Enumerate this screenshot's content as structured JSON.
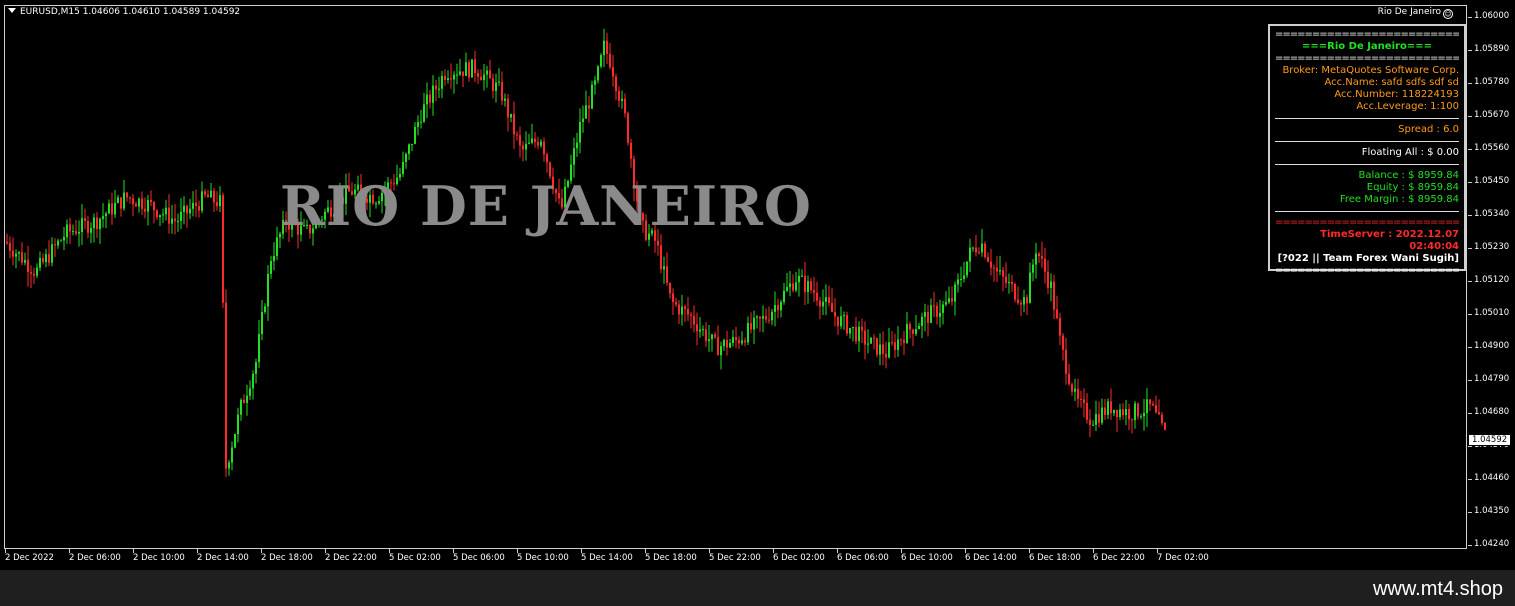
{
  "header": {
    "symbol_line": "EURUSD,M15  1.04606 1.04610 1.04589 1.04592",
    "ea_name": "Rio De Janeiro",
    "ea_icon": "smiley-icon"
  },
  "watermark": "RIO DE JANEIRO",
  "y_axis": [
    "1.06000",
    "1.05890",
    "1.05780",
    "1.05670",
    "1.05560",
    "1.05450",
    "1.05340",
    "1.05230",
    "1.05120",
    "1.05010",
    "1.04900",
    "1.04790",
    "1.04680",
    "1.04570",
    "1.04460",
    "1.04350",
    "1.04240"
  ],
  "x_axis": [
    "2 Dec 2022",
    "2 Dec 06:00",
    "2 Dec 10:00",
    "2 Dec 14:00",
    "2 Dec 18:00",
    "2 Dec 22:00",
    "5 Dec 02:00",
    "5 Dec 06:00",
    "5 Dec 10:00",
    "5 Dec 14:00",
    "5 Dec 18:00",
    "5 Dec 22:00",
    "6 Dec 02:00",
    "6 Dec 06:00",
    "6 Dec 10:00",
    "6 Dec 14:00",
    "6 Dec 18:00",
    "6 Dec 22:00",
    "7 Dec 02:00"
  ],
  "current_price": "1.04592",
  "panel": {
    "sep": "============================",
    "title": "===Rio De Janeiro===",
    "broker": "Broker: MetaQuotes Software Corp.",
    "acc_name": "Acc.Name: safd    sdfs sdf  sd",
    "acc_number": "Acc.Number: 118224193",
    "acc_leverage": "Acc.Leverage: 1:100",
    "spread": "Spread :  6.0",
    "floating": "Floating All  : $ 0.00",
    "balance": "Balance   : $ 8959.84",
    "equity": "Equity   : $ 8959.84",
    "free_margin": "Free Margin : $ 8959.84",
    "red_sep": "============================",
    "time_server": "TimeServer : 2022.12.07 02:40:04",
    "team": "[?022 || Team Forex Wani Sugih]"
  },
  "footer": {
    "site": "www.mt4.shop"
  },
  "colors": {
    "bull": "#22e022",
    "bear": "#ff2a2a",
    "background": "#000000"
  },
  "chart_data": {
    "type": "candlestick",
    "ylim": [
      1.0424,
      1.06
    ],
    "keypoints": [
      [
        0,
        1.0525
      ],
      [
        30,
        1.0515
      ],
      [
        60,
        1.0528
      ],
      [
        90,
        1.0532
      ],
      [
        120,
        1.054
      ],
      [
        140,
        1.0538
      ],
      [
        170,
        1.0532
      ],
      [
        200,
        1.054
      ],
      [
        215,
        1.0538
      ],
      [
        220,
        1.045
      ],
      [
        235,
        1.047
      ],
      [
        250,
        1.0485
      ],
      [
        265,
        1.052
      ],
      [
        280,
        1.0532
      ],
      [
        300,
        1.0528
      ],
      [
        320,
        1.0535
      ],
      [
        345,
        1.0542
      ],
      [
        370,
        1.054
      ],
      [
        395,
        1.0548
      ],
      [
        415,
        1.0568
      ],
      [
        440,
        1.0582
      ],
      [
        470,
        1.0583
      ],
      [
        495,
        1.0575
      ],
      [
        515,
        1.0555
      ],
      [
        535,
        1.056
      ],
      [
        555,
        1.0535
      ],
      [
        575,
        1.0565
      ],
      [
        590,
        1.0578
      ],
      [
        598,
        1.059
      ],
      [
        605,
        1.0585
      ],
      [
        620,
        1.0565
      ],
      [
        635,
        1.053
      ],
      [
        650,
        1.0525
      ],
      [
        665,
        1.0505
      ],
      [
        685,
        1.05
      ],
      [
        710,
        1.049
      ],
      [
        730,
        1.0492
      ],
      [
        760,
        1.05
      ],
      [
        790,
        1.0513
      ],
      [
        810,
        1.0508
      ],
      [
        830,
        1.05
      ],
      [
        860,
        1.0492
      ],
      [
        880,
        1.0488
      ],
      [
        900,
        1.0495
      ],
      [
        920,
        1.05
      ],
      [
        945,
        1.0505
      ],
      [
        965,
        1.0522
      ],
      [
        975,
        1.0525
      ],
      [
        990,
        1.0515
      ],
      [
        1010,
        1.0508
      ],
      [
        1020,
        1.0505
      ],
      [
        1030,
        1.0523
      ],
      [
        1045,
        1.051
      ],
      [
        1055,
        1.049
      ],
      [
        1070,
        1.0472
      ],
      [
        1085,
        1.0466
      ],
      [
        1105,
        1.047
      ],
      [
        1125,
        1.0468
      ],
      [
        1145,
        1.047
      ],
      [
        1160,
        1.046
      ]
    ]
  }
}
